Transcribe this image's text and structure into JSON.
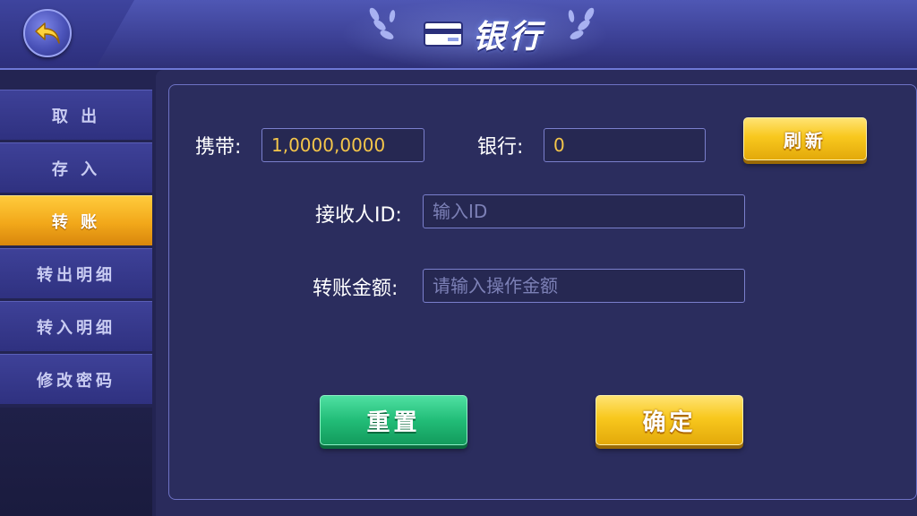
{
  "header": {
    "title": "银行",
    "back_icon": "back-arrow-icon",
    "title_icon": "bank-card-icon"
  },
  "sidebar": {
    "items": [
      {
        "label": "取 出",
        "active": false
      },
      {
        "label": "存 入",
        "active": false
      },
      {
        "label": "转 账",
        "active": true
      },
      {
        "label": "转出明细",
        "active": false
      },
      {
        "label": "转入明细",
        "active": false
      },
      {
        "label": "修改密码",
        "active": false
      }
    ]
  },
  "form": {
    "carry_label": "携带:",
    "carry_value": "1,0000,0000",
    "bank_label": "银行:",
    "bank_value": "0",
    "refresh_label": "刷新",
    "recipient_label": "接收人ID:",
    "recipient_placeholder": "输入ID",
    "amount_label": "转账金额:",
    "amount_placeholder": "请输入操作金额",
    "reset_label": "重置",
    "confirm_label": "确定"
  },
  "colors": {
    "accent_yellow": "#f8c81e",
    "accent_green": "#22bd78",
    "value_text": "#f4c64a",
    "background": "#2a2b5c"
  }
}
